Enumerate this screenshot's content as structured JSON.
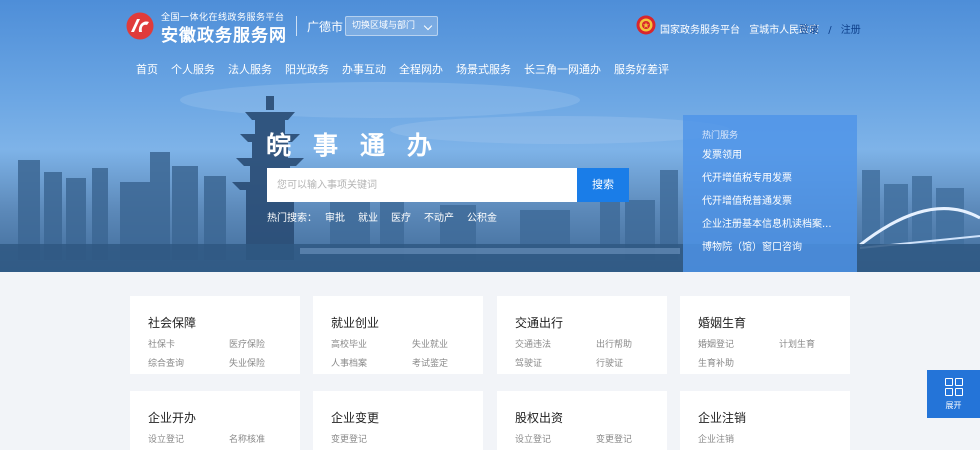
{
  "header": {
    "brand_sub": "全国一体化在线政务服务平台",
    "brand_main": "安徽政务服务网",
    "city": "广德市",
    "region_switch": "切换区域与部门",
    "gov_links": [
      "国家政务服务平台",
      "宣城市人民政府"
    ],
    "login": "登录",
    "separator": "/",
    "register": "注册"
  },
  "nav": [
    "首页",
    "个人服务",
    "法人服务",
    "阳光政务",
    "办事互动",
    "全程网办",
    "场景式服务",
    "长三角一网通办",
    "服务好差评"
  ],
  "search": {
    "slogan": "皖事通办",
    "placeholder": "您可以输入事项关键词",
    "button": "搜索",
    "hot_label": "热门搜索：",
    "hot_terms": [
      "审批",
      "就业",
      "医疗",
      "不动产",
      "公积金"
    ]
  },
  "hot_services": {
    "title": "热门服务",
    "items": [
      "发票领用",
      "代开增值税专用发票",
      "代开增值税普通发票",
      "企业注册基本信息机读档案...",
      "博物院（馆）窗口咨询"
    ]
  },
  "categories": [
    {
      "title": "社会保障",
      "links": [
        "社保卡",
        "医疗保险",
        "综合查询",
        "失业保险"
      ]
    },
    {
      "title": "就业创业",
      "links": [
        "高校毕业",
        "失业就业",
        "人事档案",
        "考试鉴定"
      ]
    },
    {
      "title": "交通出行",
      "links": [
        "交通违法",
        "出行帮助",
        "驾驶证",
        "行驶证"
      ]
    },
    {
      "title": "婚姻生育",
      "links": [
        "婚姻登记",
        "计划生育",
        "生育补助"
      ]
    },
    {
      "title": "企业开办",
      "links": [
        "设立登记",
        "名称核准"
      ]
    },
    {
      "title": "企业变更",
      "links": [
        "变更登记"
      ]
    },
    {
      "title": "股权出资",
      "links": [
        "设立登记",
        "变更登记"
      ]
    },
    {
      "title": "企业注销",
      "links": [
        "企业注销"
      ]
    }
  ],
  "expand": {
    "label": "展开"
  },
  "colors": {
    "primary": "#1a7de8",
    "login_link": "#0d3f8a",
    "hot_panel": "#4e94e8"
  }
}
